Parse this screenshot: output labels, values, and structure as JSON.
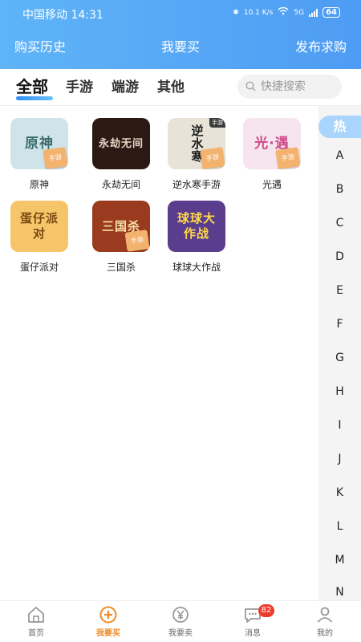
{
  "status_bar": {
    "carrier_time": "中国移动 14:31",
    "net_speed": "10.1 K/s",
    "network": "5G",
    "battery": "64"
  },
  "header": {
    "left_link": "购买历史",
    "title": "我要买",
    "right_link": "发布求购"
  },
  "category_tabs": [
    {
      "label": "全部",
      "active": true
    },
    {
      "label": "手游"
    },
    {
      "label": "端游"
    },
    {
      "label": "其他"
    }
  ],
  "search": {
    "placeholder": "快捷搜索"
  },
  "games": [
    {
      "name": "原神",
      "art": "原神",
      "tag": "手游",
      "color": "#cfe3e8"
    },
    {
      "name": "永劫无间",
      "art": "永劫无间",
      "tag": "",
      "color": "#2b1a14"
    },
    {
      "name": "逆水寒手游",
      "art": "逆水寒",
      "tag": "手游",
      "badge": "手游",
      "color": "#e8e3d6"
    },
    {
      "name": "光遇",
      "art": "光·遇",
      "tag": "手游",
      "color": "#f6e5ee"
    },
    {
      "name": "蛋仔派对",
      "art": "蛋仔派对",
      "tag": "",
      "color": "#f6c56a"
    },
    {
      "name": "三国杀",
      "art": "三国杀",
      "tag": "手游",
      "color": "#9a3a1e"
    },
    {
      "name": "球球大作战",
      "art": "球球大作战",
      "tag": "",
      "color": "#5a3d8c"
    }
  ],
  "tag_labels": {
    "mobile": "手游"
  },
  "index_bar": {
    "hot": "热",
    "letters": [
      "A",
      "B",
      "C",
      "D",
      "E",
      "F",
      "G",
      "H",
      "I",
      "J",
      "K",
      "L",
      "M",
      "N"
    ]
  },
  "tabbar": [
    {
      "label": "首页",
      "icon": "home-icon"
    },
    {
      "label": "我要买",
      "icon": "buy-plus-icon",
      "active": true
    },
    {
      "label": "我要卖",
      "icon": "sell-yen-icon"
    },
    {
      "label": "消息",
      "icon": "message-icon",
      "badge": "82"
    },
    {
      "label": "我的",
      "icon": "profile-icon"
    }
  ],
  "colors": {
    "header_start": "#5fb4f7",
    "header_end": "#4e9cf4",
    "active_tab": "#f08a24",
    "badge": "#ef3b2d",
    "hot_index": "#a9d4fb"
  }
}
